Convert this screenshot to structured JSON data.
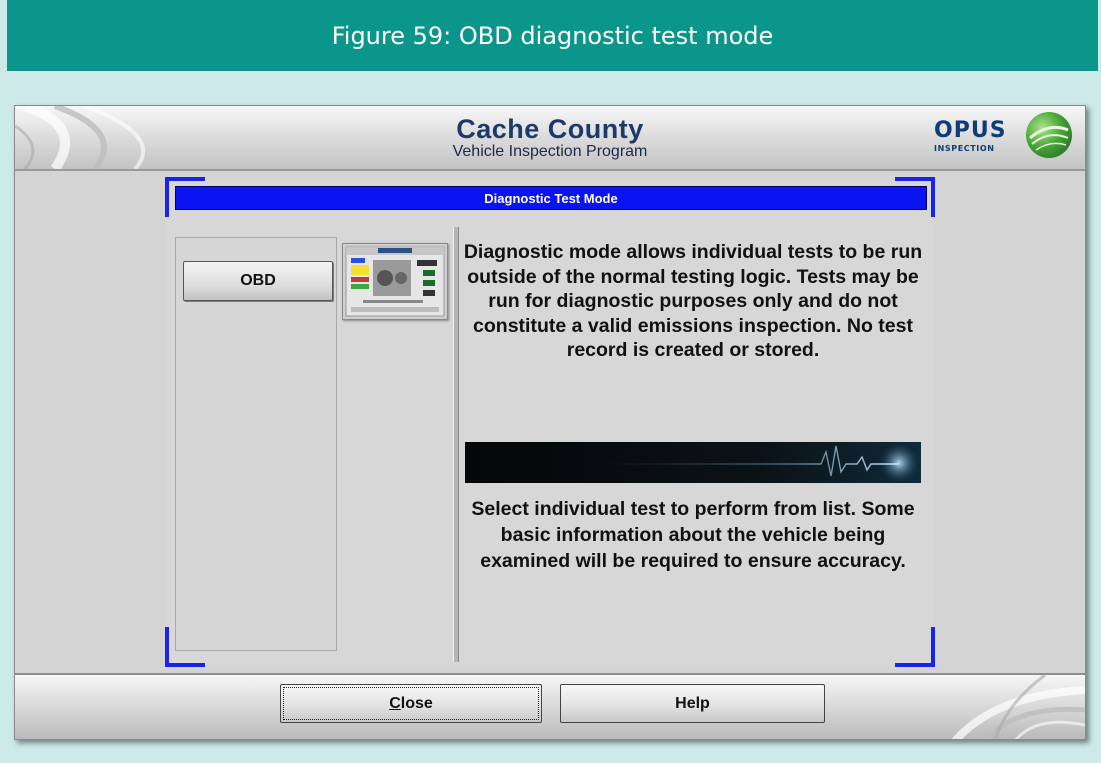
{
  "figure": {
    "caption": "Figure 59: OBD diagnostic test mode"
  },
  "app": {
    "title": "Cache County",
    "subtitle": "Vehicle Inspection Program",
    "logo": {
      "name": "OPUS",
      "tagline": "INSPECTION"
    }
  },
  "dialog": {
    "title": "Diagnostic Test Mode",
    "tests": [
      {
        "label": "OBD"
      }
    ],
    "description": "Diagnostic mode allows individual tests to be run outside of the normal testing logic. Tests may be run for diagnostic purposes only and do not constitute a valid emissions inspection. No test record is created or stored.",
    "instructions": "Select individual test to perform from list.  Some basic information about the vehicle being examined will be required to ensure accuracy."
  },
  "footer": {
    "close_label_hotkey": "C",
    "close_label_rest": "lose",
    "help_label": "Help"
  },
  "colors": {
    "figure_header": "#0a968a",
    "figure_background": "#cde9e8",
    "dialog_title_bar": "#0a14f0",
    "app_title": "#1b3a6b"
  }
}
